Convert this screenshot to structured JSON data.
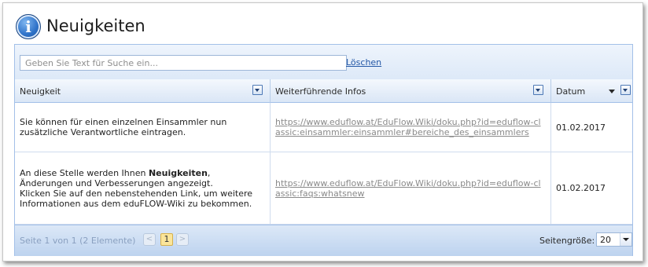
{
  "header": {
    "title": "Neuigkeiten",
    "icon": "info-icon"
  },
  "search": {
    "placeholder": "Geben Sie Text für Suche ein...",
    "value": "",
    "clear_label": "Löschen"
  },
  "columns": [
    {
      "label": "Neuigkeit"
    },
    {
      "label": "Weiterführende Infos"
    },
    {
      "label": "Datum",
      "sort": "descending"
    }
  ],
  "rows": [
    {
      "text": "Sie können für einen einzelnen Einsammler nun zusätzliche Verantwortliche eintragen.",
      "link": "https://www.eduflow.at/EduFlow.Wiki/doku.php?id=eduflow-classic:einsammler:einsammler#bereiche_des_einsammlers",
      "date": "01.02.2017"
    },
    {
      "text_before": "An diese Stelle werden Ihnen ",
      "text_bold": "Neuigkeiten",
      "text_after": ", Änderungen und Verbesserungen angezeigt.",
      "text_line2": "Klicken Sie auf den nebenstehenden Link, um weitere Informationen aus dem eduFLOW-Wiki zu bekommen.",
      "link": "https://www.eduflow.at/EduFlow.Wiki/doku.php?id=eduflow-classic:faqs:whatsnew",
      "date": "01.02.2017"
    }
  ],
  "pager": {
    "summary": "Seite 1 von 1 (2 Elemente)",
    "prev": "<",
    "current_page": "1",
    "next": ">",
    "page_size_label": "Seitengröße:",
    "page_size_value": "20"
  },
  "colors": {
    "accent": "#a3c0e8",
    "link": "#2357a6",
    "current_page": "#fbe59a"
  }
}
